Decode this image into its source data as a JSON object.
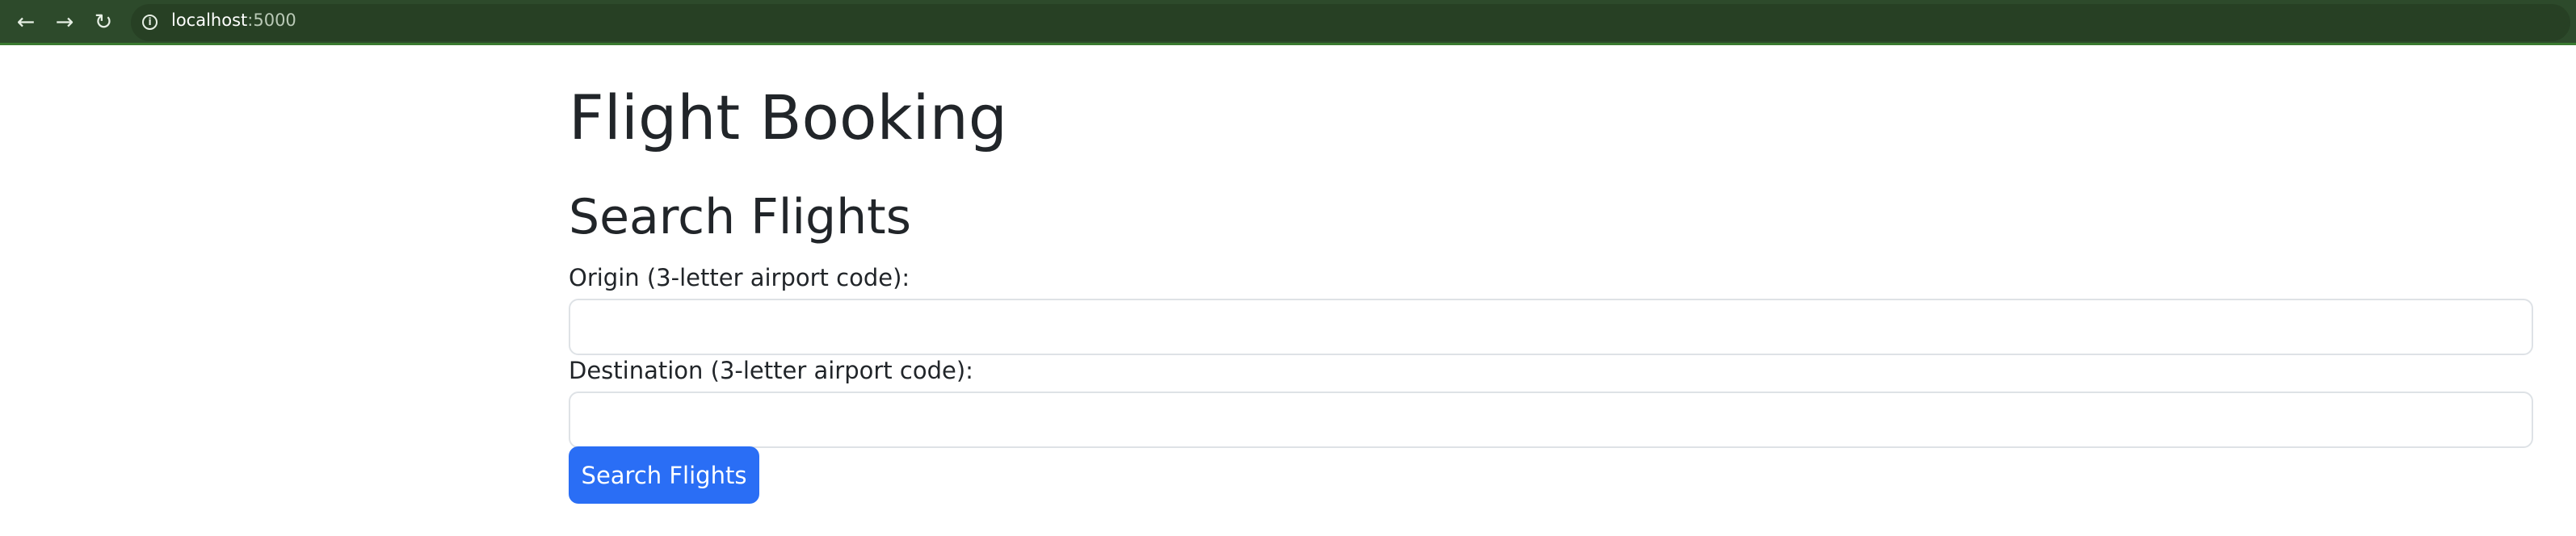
{
  "browser": {
    "back_icon": "arrow-left-icon",
    "forward_icon": "arrow-right-icon",
    "reload_icon": "reload-icon",
    "site_info_icon": "info-icon",
    "url_host": "localhost",
    "url_port": ":5000"
  },
  "page": {
    "title": "Flight Booking",
    "section_title": "Search Flights"
  },
  "form": {
    "origin_label": "Origin (3-letter airport code):",
    "origin_value": "",
    "destination_label": "Destination (3-letter airport code):",
    "destination_value": "",
    "submit_label": "Search Flights",
    "submit_color": "#2a6ef5"
  },
  "colors": {
    "browser_bar": "#2d4a2b",
    "accent": "#2a6ef5"
  }
}
